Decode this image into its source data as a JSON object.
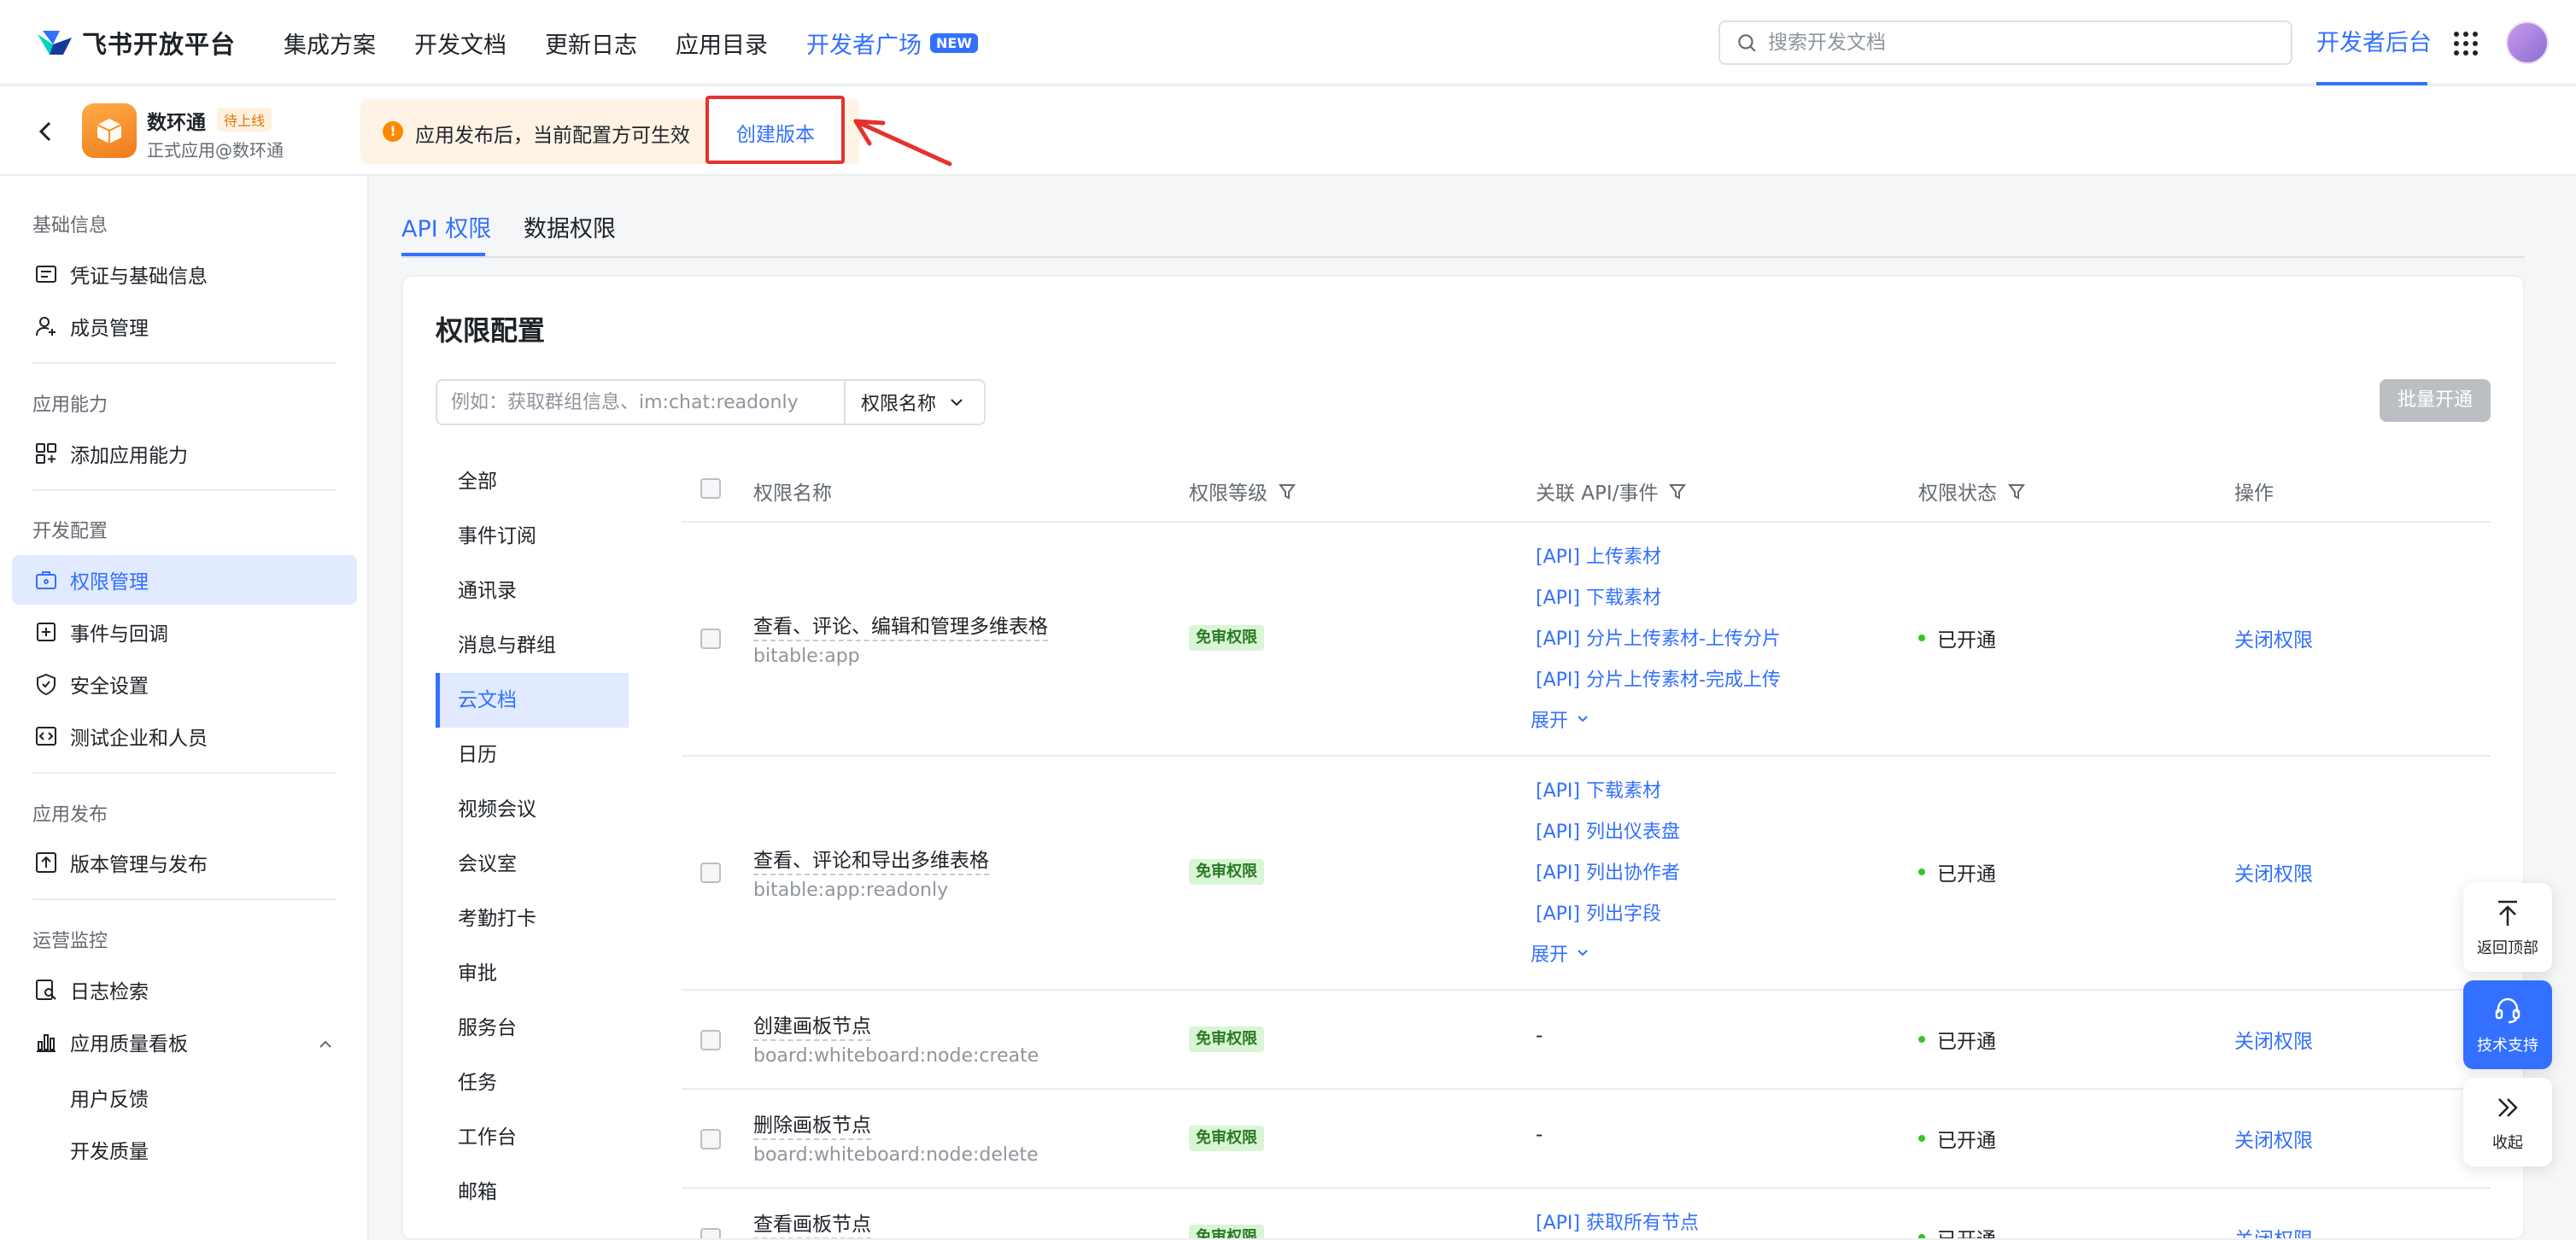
{
  "topnav": {
    "brand": "飞书开放平台",
    "links": [
      "集成方案",
      "开发文档",
      "更新日志",
      "应用目录"
    ],
    "active_link": "开发者广场",
    "new_badge": "NEW",
    "search_placeholder": "搜索开发文档",
    "dev_console": "开发者后台"
  },
  "app": {
    "name": "数环通",
    "badge": "待上线",
    "subtitle": "正式应用@数环通",
    "notice": "应用发布后，当前配置方可生效",
    "create_version": "创建版本"
  },
  "sidebar": {
    "groups": {
      "basic": "基础信息",
      "capability": "应用能力",
      "dev_config": "开发配置",
      "release": "应用发布",
      "ops": "运营监控"
    },
    "items": {
      "credentials": "凭证与基础信息",
      "members": "成员管理",
      "add_capability": "添加应用能力",
      "permissions": "权限管理",
      "events": "事件与回调",
      "security": "安全设置",
      "test_org": "测试企业和人员",
      "versions": "版本管理与发布",
      "logs": "日志检索",
      "quality": "应用质量看板",
      "feedback": "用户反馈",
      "dev_quality": "开发质量"
    }
  },
  "tabs": {
    "api": "API 权限",
    "data": "数据权限"
  },
  "permissions": {
    "title": "权限配置",
    "search_placeholder": "例如：获取群组信息、im:chat:readonly",
    "select_value": "权限名称",
    "batch_button": "批量开通",
    "categories": [
      "全部",
      "事件订阅",
      "通讯录",
      "消息与群组",
      "云文档",
      "日历",
      "视频会议",
      "会议室",
      "考勤打卡",
      "审批",
      "服务台",
      "任务",
      "工作台",
      "邮箱"
    ],
    "active_category": "云文档",
    "columns": {
      "name": "权限名称",
      "level": "权限等级",
      "api": "关联 API/事件",
      "status": "权限状态",
      "action": "操作"
    },
    "rows": [
      {
        "name": "查看、评论、编辑和管理多维表格",
        "code": "bitable:app",
        "level": "免审权限",
        "apis": [
          "[API] 上传素材",
          "[API] 下载素材",
          "[API] 分片上传素材-上传分片",
          "[API] 分片上传素材-完成上传"
        ],
        "expand": "展开",
        "status": "已开通",
        "action": "关闭权限"
      },
      {
        "name": "查看、评论和导出多维表格",
        "code": "bitable:app:readonly",
        "level": "免审权限",
        "apis": [
          "[API] 下载素材",
          "[API] 列出仪表盘",
          "[API] 列出协作者",
          "[API] 列出字段"
        ],
        "expand": "展开",
        "status": "已开通",
        "action": "关闭权限"
      },
      {
        "name": "创建画板节点",
        "code": "board:whiteboard:node:create",
        "level": "免审权限",
        "apis_text": "-",
        "status": "已开通",
        "action": "关闭权限"
      },
      {
        "name": "删除画板节点",
        "code": "board:whiteboard:node:delete",
        "level": "免审权限",
        "apis_text": "-",
        "status": "已开通",
        "action": "关闭权限"
      },
      {
        "name": "查看画板节点",
        "level": "免审权限",
        "apis": [
          "[API] 获取所有节点"
        ],
        "status": "已开通",
        "action": "关闭权限"
      }
    ]
  },
  "floating": {
    "back_top": "返回顶部",
    "support": "技术支持",
    "collapse": "收起"
  },
  "colors": {
    "accent": "#3370ff",
    "highlight_box": "#e5322d",
    "warning": "#ff8800",
    "success": "#34c724"
  }
}
